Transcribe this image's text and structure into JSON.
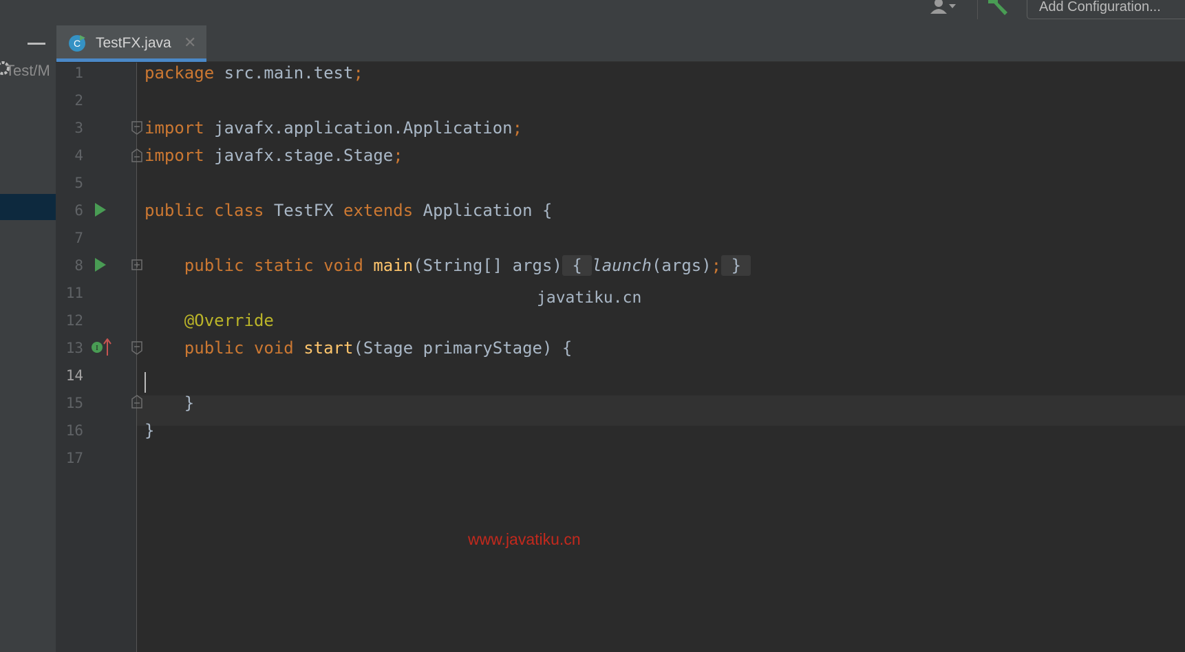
{
  "toolbar": {
    "add_configuration_label": "Add Configuration...",
    "user_icon": "user-dropdown-icon",
    "build_icon": "hammer-icon"
  },
  "left_panel": {
    "path_text": "Test/M",
    "gear_icon": "gear-icon",
    "minimize_icon": "minimize-icon"
  },
  "tabs": [
    {
      "label": "TestFX.java",
      "icon": "java-class-icon",
      "close_icon": "close-icon",
      "active": true
    }
  ],
  "editor": {
    "line_numbers": [
      "1",
      "2",
      "3",
      "4",
      "5",
      "6",
      "7",
      "8",
      "11",
      "12",
      "13",
      "14",
      "15",
      "16",
      "17"
    ],
    "current_line": "14",
    "lines": {
      "l1": {
        "kw": "package",
        "rest": " src.main.test",
        "semi": ";"
      },
      "l3": {
        "kw": "import",
        "rest": " javafx.application.Application",
        "semi": ";"
      },
      "l4": {
        "kw": "import",
        "rest": " javafx.stage.Stage",
        "semi": ";"
      },
      "l6": {
        "kw1": "public",
        "kw2": "class",
        "name": "TestFX",
        "kw3": "extends",
        "rest": "Application {"
      },
      "l8": {
        "kw1": "public",
        "kw2": "static",
        "kw3": "void",
        "fn": "main",
        "params": "(String[] args)",
        "fold_open": "{",
        "call": "launch",
        "args": "(args)",
        "semi": ";",
        "fold_close": "}"
      },
      "l12": {
        "annotation": "@Override"
      },
      "l13": {
        "kw1": "public",
        "kw2": "void",
        "fn": "start",
        "params": "(Stage primaryStage) {"
      },
      "l15": {
        "text": "}"
      },
      "l16": {
        "text": "}"
      }
    },
    "watermark_center": "javatiku.cn",
    "watermark_bottom": "www.javatiku.cn"
  },
  "colors": {
    "keyword": "#cc7832",
    "function": "#ffc66d",
    "annotation": "#bbb529",
    "text": "#a9b7c6",
    "run_green": "#499c54",
    "watermark_red": "#c3291d"
  }
}
